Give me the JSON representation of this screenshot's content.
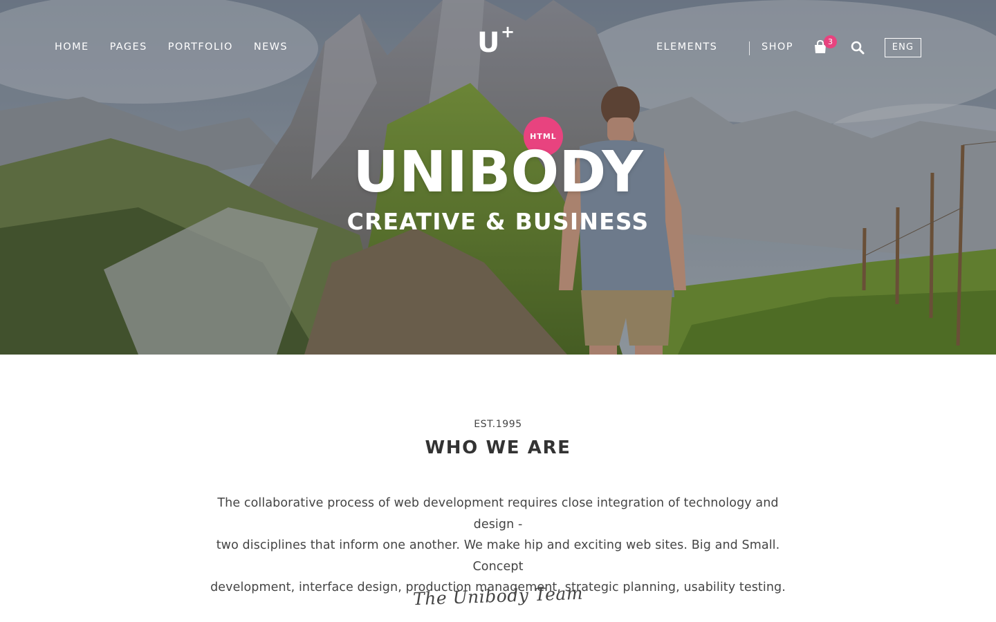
{
  "nav": {
    "left_items": [
      {
        "label": "HOME"
      },
      {
        "label": "PAGES"
      },
      {
        "label": "PORTFOLIO"
      },
      {
        "label": "NEWS"
      }
    ],
    "logo": {
      "letter": "U",
      "sup": "+"
    },
    "elements_label": "ELEMENTS",
    "shop_label": "SHOP",
    "cart_count": "3",
    "cart_icon": "shopping-bag-icon",
    "search_icon": "search-icon",
    "language": "ENG"
  },
  "hero": {
    "badge": "HTML",
    "title": "UNIBODY",
    "subtitle": "CREATIVE & BUSINESS"
  },
  "about": {
    "est": "EST.1995",
    "title": "WHO WE ARE",
    "lines": [
      "The collaborative process of web development requires close integration of technology and design -",
      "two disciplines that inform one another. We make hip and exciting web sites. Big and Small. Concept",
      "development, interface design, production management, strategic planning, usability testing."
    ],
    "signature": "The Unibody Team"
  },
  "colors": {
    "accent": "#e8437f",
    "text": "#333333",
    "white": "#ffffff"
  }
}
